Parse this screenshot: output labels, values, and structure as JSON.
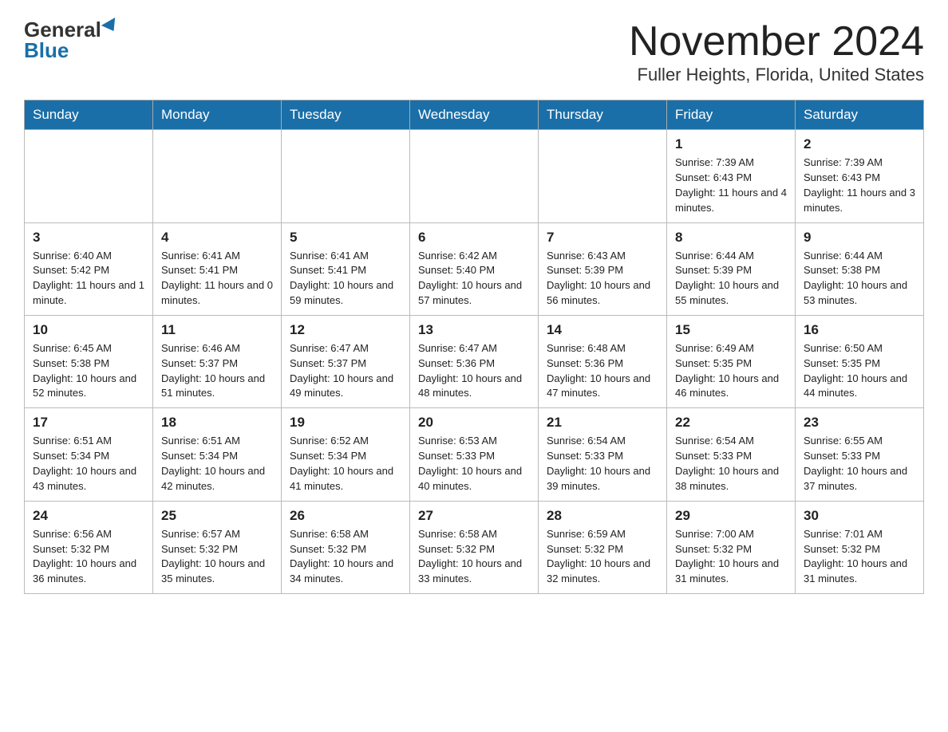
{
  "header": {
    "logo_general": "General",
    "logo_blue": "Blue",
    "month_title": "November 2024",
    "location": "Fuller Heights, Florida, United States"
  },
  "calendar": {
    "weekdays": [
      "Sunday",
      "Monday",
      "Tuesday",
      "Wednesday",
      "Thursday",
      "Friday",
      "Saturday"
    ],
    "weeks": [
      [
        {
          "day": "",
          "info": ""
        },
        {
          "day": "",
          "info": ""
        },
        {
          "day": "",
          "info": ""
        },
        {
          "day": "",
          "info": ""
        },
        {
          "day": "",
          "info": ""
        },
        {
          "day": "1",
          "info": "Sunrise: 7:39 AM\nSunset: 6:43 PM\nDaylight: 11 hours and 4 minutes."
        },
        {
          "day": "2",
          "info": "Sunrise: 7:39 AM\nSunset: 6:43 PM\nDaylight: 11 hours and 3 minutes."
        }
      ],
      [
        {
          "day": "3",
          "info": "Sunrise: 6:40 AM\nSunset: 5:42 PM\nDaylight: 11 hours and 1 minute."
        },
        {
          "day": "4",
          "info": "Sunrise: 6:41 AM\nSunset: 5:41 PM\nDaylight: 11 hours and 0 minutes."
        },
        {
          "day": "5",
          "info": "Sunrise: 6:41 AM\nSunset: 5:41 PM\nDaylight: 10 hours and 59 minutes."
        },
        {
          "day": "6",
          "info": "Sunrise: 6:42 AM\nSunset: 5:40 PM\nDaylight: 10 hours and 57 minutes."
        },
        {
          "day": "7",
          "info": "Sunrise: 6:43 AM\nSunset: 5:39 PM\nDaylight: 10 hours and 56 minutes."
        },
        {
          "day": "8",
          "info": "Sunrise: 6:44 AM\nSunset: 5:39 PM\nDaylight: 10 hours and 55 minutes."
        },
        {
          "day": "9",
          "info": "Sunrise: 6:44 AM\nSunset: 5:38 PM\nDaylight: 10 hours and 53 minutes."
        }
      ],
      [
        {
          "day": "10",
          "info": "Sunrise: 6:45 AM\nSunset: 5:38 PM\nDaylight: 10 hours and 52 minutes."
        },
        {
          "day": "11",
          "info": "Sunrise: 6:46 AM\nSunset: 5:37 PM\nDaylight: 10 hours and 51 minutes."
        },
        {
          "day": "12",
          "info": "Sunrise: 6:47 AM\nSunset: 5:37 PM\nDaylight: 10 hours and 49 minutes."
        },
        {
          "day": "13",
          "info": "Sunrise: 6:47 AM\nSunset: 5:36 PM\nDaylight: 10 hours and 48 minutes."
        },
        {
          "day": "14",
          "info": "Sunrise: 6:48 AM\nSunset: 5:36 PM\nDaylight: 10 hours and 47 minutes."
        },
        {
          "day": "15",
          "info": "Sunrise: 6:49 AM\nSunset: 5:35 PM\nDaylight: 10 hours and 46 minutes."
        },
        {
          "day": "16",
          "info": "Sunrise: 6:50 AM\nSunset: 5:35 PM\nDaylight: 10 hours and 44 minutes."
        }
      ],
      [
        {
          "day": "17",
          "info": "Sunrise: 6:51 AM\nSunset: 5:34 PM\nDaylight: 10 hours and 43 minutes."
        },
        {
          "day": "18",
          "info": "Sunrise: 6:51 AM\nSunset: 5:34 PM\nDaylight: 10 hours and 42 minutes."
        },
        {
          "day": "19",
          "info": "Sunrise: 6:52 AM\nSunset: 5:34 PM\nDaylight: 10 hours and 41 minutes."
        },
        {
          "day": "20",
          "info": "Sunrise: 6:53 AM\nSunset: 5:33 PM\nDaylight: 10 hours and 40 minutes."
        },
        {
          "day": "21",
          "info": "Sunrise: 6:54 AM\nSunset: 5:33 PM\nDaylight: 10 hours and 39 minutes."
        },
        {
          "day": "22",
          "info": "Sunrise: 6:54 AM\nSunset: 5:33 PM\nDaylight: 10 hours and 38 minutes."
        },
        {
          "day": "23",
          "info": "Sunrise: 6:55 AM\nSunset: 5:33 PM\nDaylight: 10 hours and 37 minutes."
        }
      ],
      [
        {
          "day": "24",
          "info": "Sunrise: 6:56 AM\nSunset: 5:32 PM\nDaylight: 10 hours and 36 minutes."
        },
        {
          "day": "25",
          "info": "Sunrise: 6:57 AM\nSunset: 5:32 PM\nDaylight: 10 hours and 35 minutes."
        },
        {
          "day": "26",
          "info": "Sunrise: 6:58 AM\nSunset: 5:32 PM\nDaylight: 10 hours and 34 minutes."
        },
        {
          "day": "27",
          "info": "Sunrise: 6:58 AM\nSunset: 5:32 PM\nDaylight: 10 hours and 33 minutes."
        },
        {
          "day": "28",
          "info": "Sunrise: 6:59 AM\nSunset: 5:32 PM\nDaylight: 10 hours and 32 minutes."
        },
        {
          "day": "29",
          "info": "Sunrise: 7:00 AM\nSunset: 5:32 PM\nDaylight: 10 hours and 31 minutes."
        },
        {
          "day": "30",
          "info": "Sunrise: 7:01 AM\nSunset: 5:32 PM\nDaylight: 10 hours and 31 minutes."
        }
      ]
    ]
  }
}
